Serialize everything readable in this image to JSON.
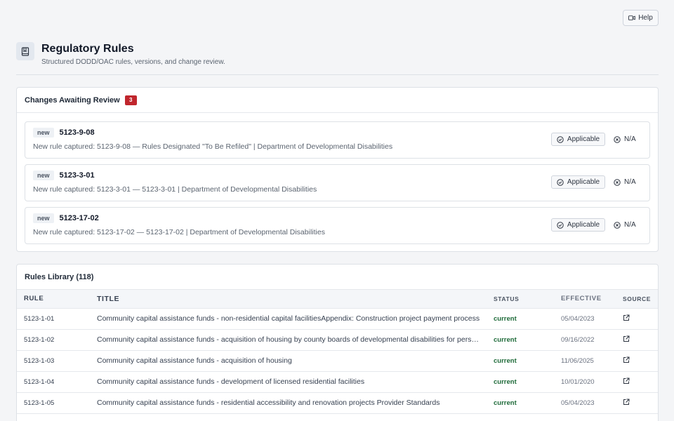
{
  "help": {
    "label": "Help",
    "icon": "video-camera-icon"
  },
  "header": {
    "icon": "book-icon",
    "title": "Regulatory Rules",
    "subtitle": "Structured DODD/OAC rules, versions, and change review."
  },
  "review": {
    "title": "Changes Awaiting Review",
    "count": "3",
    "badge_color": "#c0262d",
    "applicable_label": "Applicable",
    "na_label": "N/A",
    "items": [
      {
        "tag": "new",
        "rule": "5123-9-08",
        "description": "New rule captured: 5123-9-08 — Rules Designated \"To Be Refiled\" | Department of Developmental Disabilities"
      },
      {
        "tag": "new",
        "rule": "5123-3-01",
        "description": "New rule captured: 5123-3-01 — 5123-3-01 | Department of Developmental Disabilities"
      },
      {
        "tag": "new",
        "rule": "5123-17-02",
        "description": "New rule captured: 5123-17-02 — 5123-17-02 | Department of Developmental Disabilities"
      }
    ]
  },
  "library": {
    "title": "Rules Library (118)",
    "columns": {
      "rule": "RULE",
      "title": "TITLE",
      "status": "STATUS",
      "effective": "EFFECTIVE",
      "source": "SOURCE"
    },
    "status_color": "#1f6b3a",
    "rows": [
      {
        "rule": "5123-1-01",
        "title": "Community capital assistance funds - non-residential capital facilitiesAppendix: Construction project payment process",
        "status": "current",
        "effective": "05/04/2023"
      },
      {
        "rule": "5123-1-02",
        "title": "Community capital assistance funds - acquisition of housing by county boards of developmental disabilities for persons",
        "status": "current",
        "effective": "09/16/2022"
      },
      {
        "rule": "5123-1-03",
        "title": "Community capital assistance funds - acquisition of housing",
        "status": "current",
        "effective": "11/06/2025"
      },
      {
        "rule": "5123-1-04",
        "title": "Community capital assistance funds - development of licensed residential facilities",
        "status": "current",
        "effective": "10/01/2020"
      },
      {
        "rule": "5123-1-05",
        "title": "Community capital assistance funds - residential accessibility and renovation projects Provider Standards",
        "status": "current",
        "effective": "05/04/2023"
      }
    ]
  }
}
